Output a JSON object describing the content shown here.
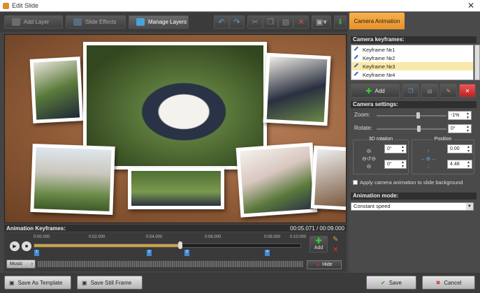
{
  "window": {
    "title": "Edit Slide",
    "close": "✕"
  },
  "toolbar": {
    "add_layer": "Add Layer",
    "slide_effects": "Slide Effects",
    "manage_layers": "Manage Layers"
  },
  "keyframes_bar": {
    "title": "Animation Keyframes:",
    "time": "00:05.071 / 00:09.000"
  },
  "timeline": {
    "ticks": [
      "0:00.000",
      "0:02.000",
      "0:04.000",
      "0:06.000",
      "0:08.000",
      "0:10.000"
    ],
    "keyframes": [
      "1",
      "2",
      "3",
      "4"
    ],
    "playhead_fraction": 0.55,
    "add_label": "Add",
    "music_label": "Music",
    "hide_label": "Hide"
  },
  "bottom": {
    "save_template": "Save As Template",
    "save_still": "Save Still Frame",
    "save": "Save",
    "cancel": "Cancel"
  },
  "right_panel": {
    "tab": "Camera Animation",
    "keyframes_title": "Camera keyframes:",
    "keyframes": [
      "Keyframe №1",
      "Keyframe №2",
      "Keyframe №3",
      "Keyframe №4"
    ],
    "selected_index": 2,
    "add_label": "Add",
    "settings_title": "Camera settings:",
    "zoom_label": "Zoom:",
    "zoom_value": "-1%",
    "rotate_label": "Rotate:",
    "rotate_value": "0°",
    "rotation3d_title": "3D rotation",
    "rot_x": "0°",
    "rot_y": "0°",
    "position_title": "Position",
    "pos_x": "0.00",
    "pos_y": "4.48",
    "apply_bg": "Apply camera animation to slide background",
    "mode_title": "Animation mode:",
    "mode_value": "Constant speed"
  },
  "colors": {
    "accent": "#e8912a",
    "keyframe": "#3f8bd6",
    "track_fill": "#c8a245"
  }
}
